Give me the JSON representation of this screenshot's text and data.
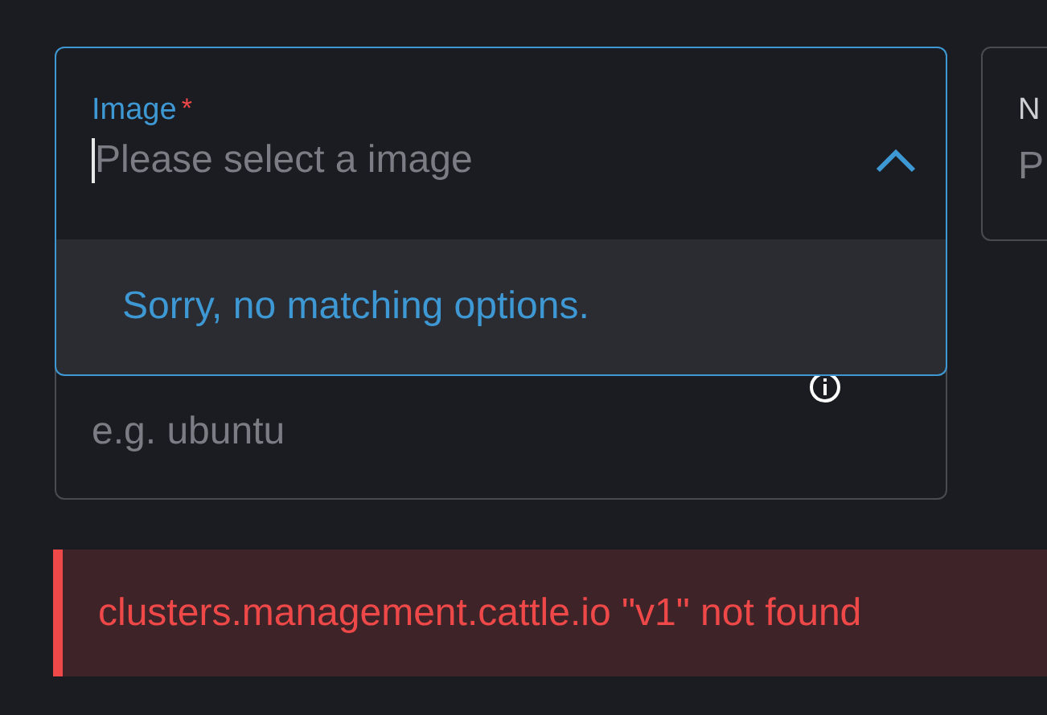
{
  "image_select": {
    "label": "Image",
    "required_mark": "*",
    "placeholder": "Please select a image",
    "expanded": true,
    "no_options_text": "Sorry, no matching options."
  },
  "second_field": {
    "placeholder": "e.g. ubuntu"
  },
  "side_field": {
    "label": "N",
    "placeholder": "P"
  },
  "error_banner": {
    "message": "clusters.management.cattle.io \"v1\" not found"
  }
}
